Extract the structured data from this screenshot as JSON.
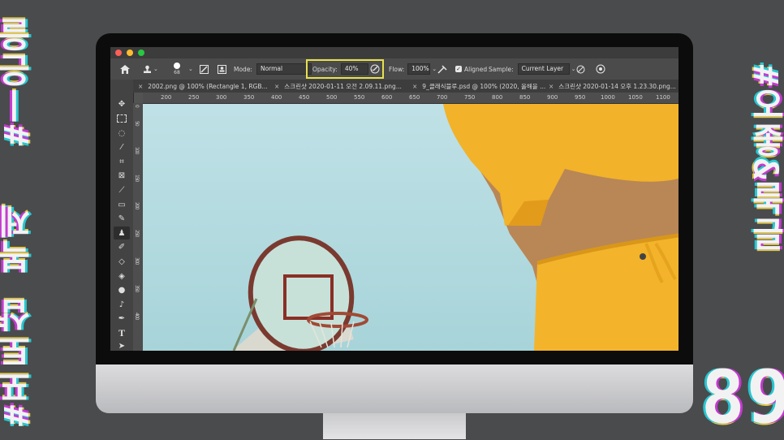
{
  "decor": {
    "left_top": "#ㅣ은을",
    "left_bottom": "#포토샵 복제",
    "right_top": "#오좋&룩글",
    "right_bottom": "89"
  },
  "options": {
    "mode_label": "Mode:",
    "mode_value": "Normal",
    "opacity_label": "Opacity:",
    "opacity_value": "40%",
    "flow_label": "Flow:",
    "flow_value": "100%",
    "aligned_label": "Aligned",
    "sample_label": "Sample:",
    "sample_value": "Current Layer",
    "brush_size": "68"
  },
  "tabs": [
    {
      "label": "2002.png @ 100% (Rectangle 1, RGB..."
    },
    {
      "label": "스크린샷 2020-01-11 오전 2.09.11.png..."
    },
    {
      "label": "9_클래식블루.psd @ 100% (2020, 올해을 ..."
    },
    {
      "label": "스크린샷 2020-01-14 오후 1.23.30.png..."
    }
  ],
  "ruler_top": [
    "200",
    "250",
    "300",
    "350",
    "400",
    "450",
    "500",
    "550",
    "600",
    "650",
    "700",
    "750",
    "800",
    "850",
    "900",
    "950",
    "1000",
    "1050",
    "1100"
  ],
  "ruler_left": [
    "0",
    "50",
    "100",
    "150",
    "200",
    "250",
    "300",
    "350",
    "400"
  ],
  "colors": {
    "highlight": "#e7e04e",
    "sky": "#a7d4d9",
    "shirt": "#f2b22a"
  }
}
